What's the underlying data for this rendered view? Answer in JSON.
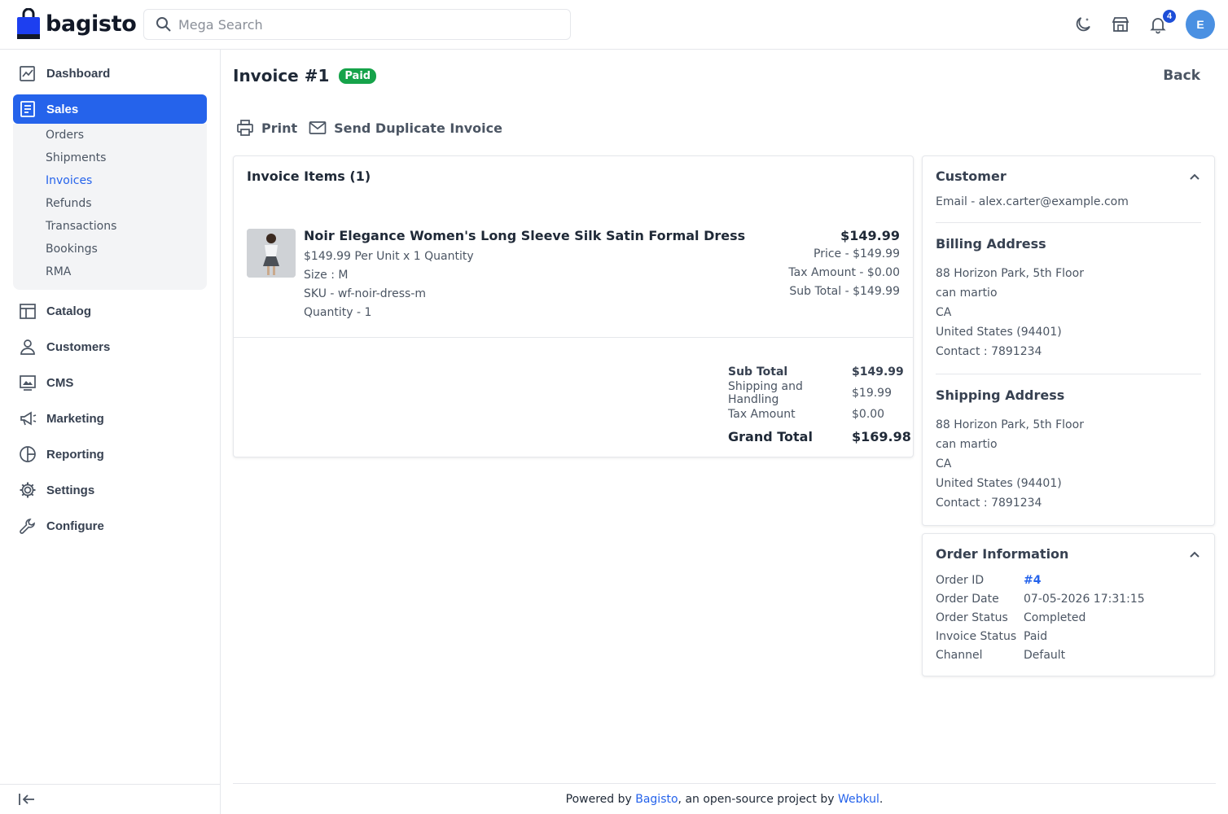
{
  "header": {
    "logo_text": "bagisto",
    "search_placeholder": "Mega Search",
    "notification_count": "4",
    "avatar_initial": "E",
    "brand_color": "#1d4ed8"
  },
  "sidebar": {
    "items": [
      {
        "label": "Dashboard",
        "icon": "dashboard-icon"
      },
      {
        "label": "Sales",
        "icon": "sales-icon",
        "active": true
      },
      {
        "label": "Catalog",
        "icon": "catalog-icon"
      },
      {
        "label": "Customers",
        "icon": "customers-icon"
      },
      {
        "label": "CMS",
        "icon": "cms-icon"
      },
      {
        "label": "Marketing",
        "icon": "marketing-icon"
      },
      {
        "label": "Reporting",
        "icon": "reporting-icon"
      },
      {
        "label": "Settings",
        "icon": "settings-icon"
      },
      {
        "label": "Configure",
        "icon": "configure-icon"
      }
    ],
    "sales_sub": [
      "Orders",
      "Shipments",
      "Invoices",
      "Refunds",
      "Transactions",
      "Bookings",
      "RMA"
    ],
    "active_sub": "Invoices"
  },
  "page": {
    "title": "Invoice #1",
    "status_badge": "Paid",
    "back_label": "Back",
    "print_label": "Print",
    "send_duplicate_label": "Send Duplicate Invoice"
  },
  "invoice_items": {
    "heading": "Invoice Items (1)",
    "items": [
      {
        "name": "Noir Elegance Women's Long Sleeve Silk Satin Formal Dress",
        "per_unit": "$149.99 Per Unit x 1 Quantity",
        "size": "Size : M",
        "sku": "SKU - wf-noir-dress-m",
        "quantity": "Quantity - 1",
        "total": "$149.99",
        "price": "Price - $149.99",
        "tax": "Tax Amount - $0.00",
        "subtotal": "Sub Total - $149.99"
      }
    ],
    "totals": {
      "sub_total_label": "Sub Total",
      "sub_total": "$149.99",
      "shipping_label": "Shipping and Handling",
      "shipping": "$19.99",
      "tax_label": "Tax Amount",
      "tax": "$0.00",
      "grand_total_label": "Grand Total",
      "grand_total": "$169.98"
    }
  },
  "customer": {
    "heading": "Customer",
    "email": "Email - alex.carter@example.com",
    "billing_heading": "Billing Address",
    "billing": [
      "88 Horizon Park, 5th Floor",
      "can martio",
      "CA",
      "United States (94401)",
      "Contact : 7891234"
    ],
    "shipping_heading": "Shipping Address",
    "shipping": [
      "88 Horizon Park, 5th Floor",
      "can martio",
      "CA",
      "United States (94401)",
      "Contact : 7891234"
    ]
  },
  "order_info": {
    "heading": "Order Information",
    "rows": [
      {
        "label": "Order ID",
        "value": "#4"
      },
      {
        "label": "Order Date",
        "value": "07-05-2026 17:31:15"
      },
      {
        "label": "Order Status",
        "value": "Completed"
      },
      {
        "label": "Invoice Status",
        "value": "Paid"
      },
      {
        "label": "Channel",
        "value": "Default"
      }
    ]
  },
  "footer": {
    "prefix": "Powered by ",
    "bagisto_link": "Bagisto",
    "middle": ", an open-source project by ",
    "webkul_link": "Webkul",
    "suffix": "."
  }
}
